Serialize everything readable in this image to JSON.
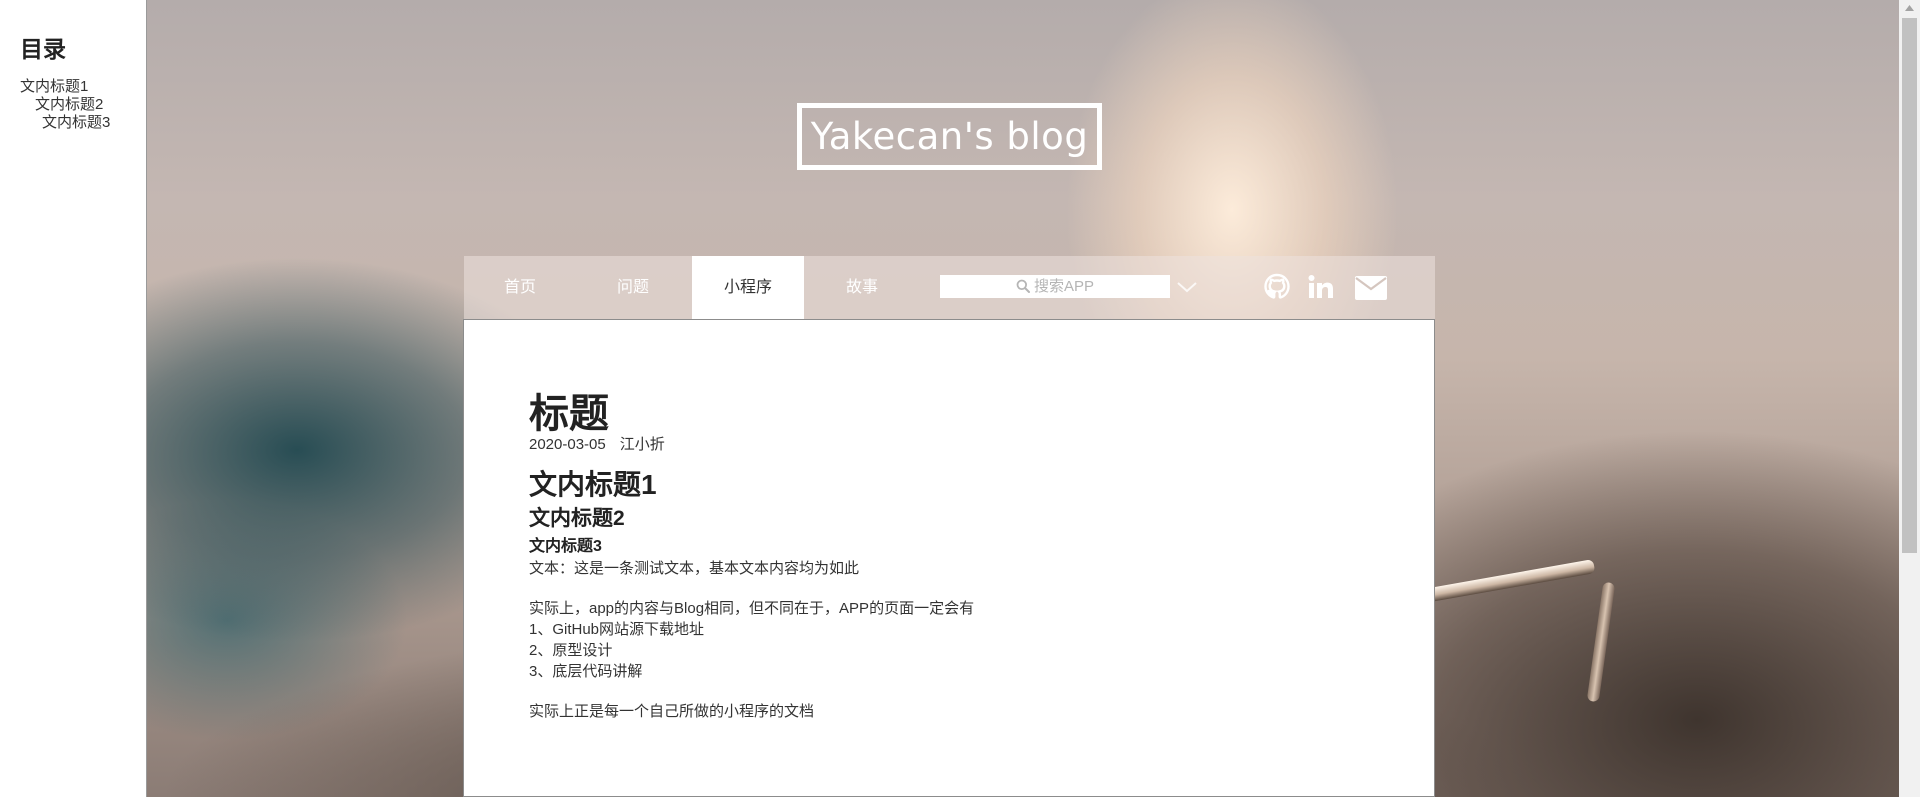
{
  "toc": {
    "title": "目录",
    "items": [
      {
        "label": "文内标题1",
        "level": 1
      },
      {
        "label": "文内标题2",
        "level": 2
      },
      {
        "label": "文内标题3",
        "level": 3
      }
    ]
  },
  "header": {
    "blog_title": "Yakecan's blog"
  },
  "nav": {
    "items": [
      {
        "label": "首页",
        "active": false
      },
      {
        "label": "问题",
        "active": false
      },
      {
        "label": "小程序",
        "active": true
      },
      {
        "label": "故事",
        "active": false
      }
    ],
    "search_placeholder": "搜索APP",
    "social_icons": [
      "github-icon",
      "linkedin-icon",
      "mail-icon"
    ]
  },
  "article": {
    "title": "标题",
    "date": "2020-03-05",
    "author": "江小折",
    "heading1": "文内标题1",
    "heading2": "文内标题2",
    "heading3": "文内标题3",
    "intro": "文本：这是一条测试文本，基本文本内容均为如此",
    "para_lead": "实际上，app的内容与Blog相同，但不同在于，APP的页面一定会有",
    "list": [
      "1、GitHub网站源下载地址",
      "2、原型设计",
      "3、底层代码讲解"
    ],
    "closing": "实际上正是每一个自己所做的小程序的文档"
  },
  "colors": {
    "active_tab_bg": "#ffffff",
    "nav_text": "#ffffff",
    "body_text": "#333333"
  }
}
